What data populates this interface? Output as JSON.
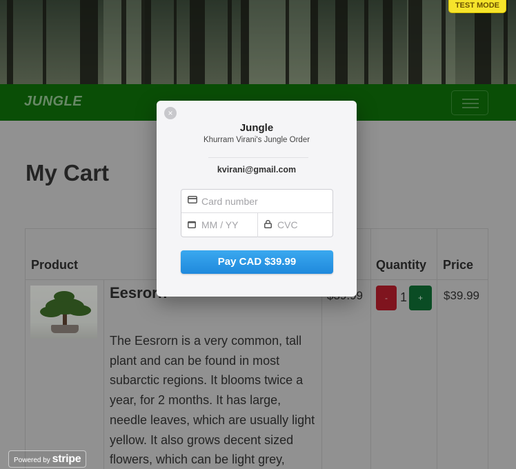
{
  "badge": {
    "test_mode": "TEST MODE"
  },
  "navbar": {
    "brand": "JUNGLE",
    "menu_toggle_icon": "hamburger-icon"
  },
  "page": {
    "title": "My Cart"
  },
  "cart_table": {
    "headers": {
      "product": "Product",
      "quantity": "Quantity",
      "price": "Price"
    },
    "rows": [
      {
        "name": "Eesrorn",
        "description": "The Eesrorn is a very common, tall plant and can be found in most subarctic regions. It blooms twice a year, for 2 months. It has large, needle leaves, which are usually light yellow. It also grows decent sized flowers, which can be light grey,",
        "unit_price": "$39.99",
        "minus_label": "-",
        "quantity": "1",
        "plus_label": "+",
        "price": "$39.99"
      }
    ]
  },
  "checkout": {
    "merchant": "Jungle",
    "description": "Khurram Virani's Jungle Order",
    "email": "kvirani@gmail.com",
    "card_number_placeholder": "Card number",
    "expiry_placeholder": "MM / YY",
    "cvc_placeholder": "CVC",
    "pay_button": "Pay CAD $39.99",
    "close_symbol": "×"
  },
  "footer": {
    "powered_by": "Powered by",
    "stripe": "stripe"
  },
  "colors": {
    "navbar": "#0e6d09",
    "pay_button": "#1f89dc",
    "minus": "#b11d2a",
    "plus": "#0f6a33",
    "badge": "#f6e42b"
  }
}
